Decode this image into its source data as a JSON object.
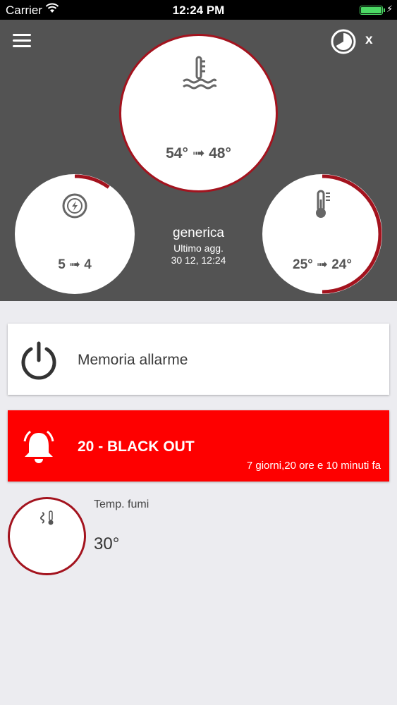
{
  "status_bar": {
    "carrier": "Carrier",
    "time": "12:24 PM",
    "battery_level": 1.0
  },
  "header": {
    "close_label": "x",
    "device_name": "generica",
    "last_update_label": "Ultimo agg.",
    "last_update_datetime": "30 12, 12:24"
  },
  "gauges": {
    "water_temp": {
      "icon": "water-temperature-icon",
      "value": "54° ➟ 48°"
    },
    "power": {
      "icon": "power-level-icon",
      "value": "5 ➟ 4",
      "level": 0.1
    },
    "room_temp": {
      "icon": "thermometer-icon",
      "value": "25° ➟ 24°",
      "level": 0.5
    }
  },
  "cards": {
    "memory": {
      "icon": "power-icon",
      "label": "Memoria allarme"
    },
    "alarm": {
      "icon": "alarm-bell-icon",
      "label": "20 - BLACK OUT",
      "sub": "7 giorni,20 ore e 10 minuti fa"
    }
  },
  "fumes": {
    "icon": "smoke-temperature-icon",
    "label": "Temp. fumi",
    "value": "30°"
  },
  "colors": {
    "accent": "#a3131e",
    "alarm": "#fe0000",
    "header_bg": "#535353",
    "page_bg": "#ececf0"
  }
}
